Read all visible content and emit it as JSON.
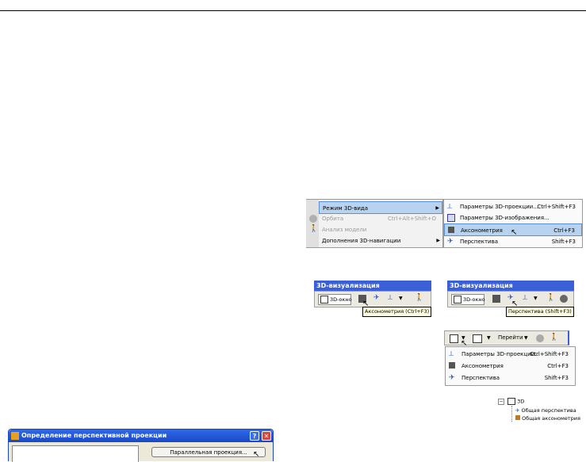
{
  "panel1": {
    "menu": {
      "items": [
        {
          "label": "Режим 3D-вида",
          "highlighted": true,
          "submenu": true
        },
        {
          "label": "Орбита",
          "shortcut": "Ctrl+Alt+Shift+O",
          "disabled": true
        },
        {
          "label": "Анализ модели",
          "disabled": true
        },
        {
          "label": "Дополнения 3D-навигации",
          "submenu": true
        }
      ]
    },
    "submenu": {
      "items": [
        {
          "label": "Параметры 3D-проекции...",
          "shortcut": "Ctrl+Shift+F3"
        },
        {
          "label": "Параметры 3D-изображения..."
        },
        {
          "label": "Аксонометрия",
          "shortcut": "Ctrl+F3",
          "highlighted": true
        },
        {
          "label": "Перспектива",
          "shortcut": "Shift+F3"
        }
      ]
    }
  },
  "panel2": {
    "title": "3D-визуализация",
    "window_button": "3D-окно",
    "tooltip": "Аксонометрия (Ctrl+F3)"
  },
  "panel3": {
    "title": "3D-визуализация",
    "window_button": "3D-окно",
    "tooltip": "Перспектива (Shift+F3)"
  },
  "panel4": {
    "goto_label": "Перейти",
    "items": [
      {
        "label": "Параметры 3D-проекции...",
        "shortcut": "Ctrl+Shift+F3"
      },
      {
        "label": "Аксонометрия",
        "shortcut": "Ctrl+F3"
      },
      {
        "label": "Перспектива",
        "shortcut": "Shift+F3"
      }
    ]
  },
  "tree": {
    "root": "3D",
    "children": [
      "Общая перспектива",
      "Общая аксонометрия"
    ]
  },
  "dialog": {
    "title": "Определение перспективной проекции",
    "help": "?",
    "close": "✕",
    "button": "Параллельная проекция..."
  },
  "colors": {
    "titlebar": "#3a5fd6",
    "highlight": "#b8d3f0",
    "tooltip_bg": "#ffffe1"
  }
}
